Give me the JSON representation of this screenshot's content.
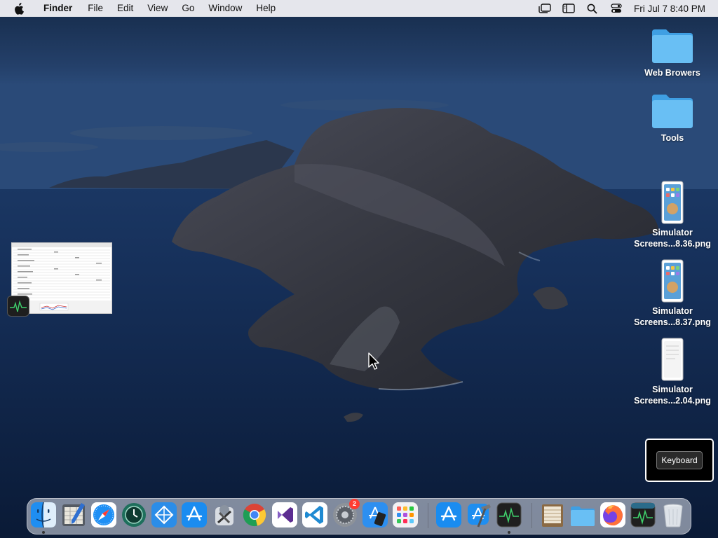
{
  "menubar": {
    "app_name": "Finder",
    "menus": [
      "File",
      "Edit",
      "View",
      "Go",
      "Window",
      "Help"
    ],
    "status_icons": [
      "stage-manager-icon",
      "sidebar-icon",
      "spotlight-search-icon",
      "control-center-icon"
    ],
    "clock": "Fri Jul 7  8:40 PM"
  },
  "desktop": {
    "items": [
      {
        "label": "Web Browers",
        "icon": "folder-icon"
      },
      {
        "label": "Tools",
        "icon": "folder-icon"
      },
      {
        "label_line1": "Simulator",
        "label_line2": "Screens...8.36.png",
        "icon": "image-file-icon"
      },
      {
        "label_line1": "Simulator",
        "label_line2": "Screens...8.37.png",
        "icon": "image-file-icon"
      },
      {
        "label_line1": "Simulator",
        "label_line2": "Screens...2.04.png",
        "icon": "image-file-icon"
      }
    ]
  },
  "keyboard_popup": {
    "button_label": "Keyboard"
  },
  "dock": {
    "apps": [
      {
        "name": "Finder",
        "icon": "finder-icon",
        "running": true
      },
      {
        "name": "Script Editor",
        "icon": "script-editor-icon"
      },
      {
        "name": "Safari",
        "icon": "safari-icon"
      },
      {
        "name": "Time Machine",
        "icon": "time-machine-icon"
      },
      {
        "name": "Migration",
        "icon": "migration-assistant-icon"
      },
      {
        "name": "App Store",
        "icon": "app-store-icon"
      },
      {
        "name": "Utility",
        "icon": "utility-icon"
      },
      {
        "name": "Chrome",
        "icon": "chrome-icon"
      },
      {
        "name": "Visual Studio",
        "icon": "visual-studio-icon"
      },
      {
        "name": "VS Code",
        "icon": "vscode-icon"
      },
      {
        "name": "System Preferences",
        "icon": "system-preferences-icon",
        "badge": "2"
      },
      {
        "name": "Simulator",
        "icon": "simulator-icon"
      },
      {
        "name": "Launchpad",
        "icon": "launchpad-icon"
      },
      {
        "name": "App Store 2",
        "icon": "app-store-icon"
      },
      {
        "name": "Xcode",
        "icon": "xcode-icon"
      },
      {
        "name": "Activity Monitor",
        "icon": "activity-monitor-icon",
        "running": true
      },
      {
        "name": "Archive",
        "icon": "archive-icon"
      },
      {
        "name": "Downloads",
        "icon": "folder-icon"
      },
      {
        "name": "Firefox",
        "icon": "firefox-icon"
      },
      {
        "name": "Activity Monitor 2",
        "icon": "activity-monitor-icon"
      },
      {
        "name": "Trash",
        "icon": "trash-icon"
      }
    ]
  },
  "colors": {
    "sky": "#1c3556",
    "sea": "#0f2545",
    "island": "#3a3b44",
    "folder": "#5ab3ef",
    "menubar": "#eeeef2"
  }
}
